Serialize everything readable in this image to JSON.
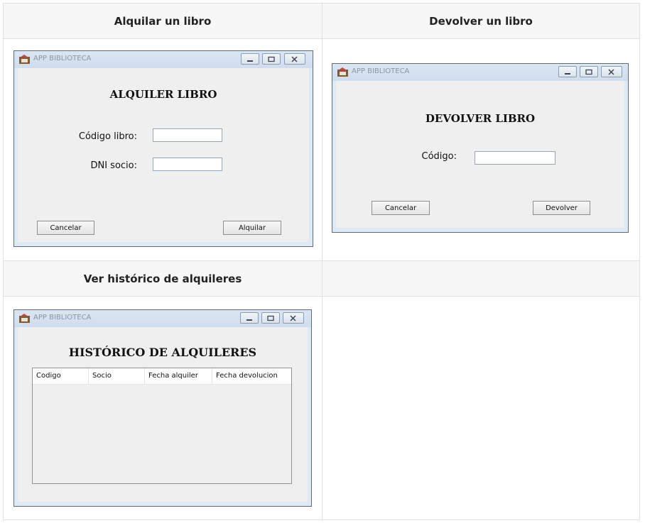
{
  "headers": {
    "alquilar": "Alquilar un libro",
    "devolver": "Devolver un libro",
    "historico": "Ver histórico de alquileres"
  },
  "windows": {
    "title": "APP BIBLIOTECA",
    "alquiler": {
      "heading": "ALQUILER LIBRO",
      "codigo_label": "Código libro:",
      "codigo_value": "",
      "dni_label": "DNI socio:",
      "dni_value": "",
      "cancel_label": "Cancelar",
      "submit_label": "Alquilar"
    },
    "devolver": {
      "heading": "DEVOLVER LIBRO",
      "codigo_label": "Código:",
      "codigo_value": "",
      "cancel_label": "Cancelar",
      "submit_label": "Devolver"
    },
    "historico": {
      "heading": "HISTÓRICO DE ALQUILERES",
      "columns": [
        "Codigo",
        "Socio",
        "Fecha alquiler",
        "Fecha devolucion"
      ],
      "rows": []
    }
  }
}
